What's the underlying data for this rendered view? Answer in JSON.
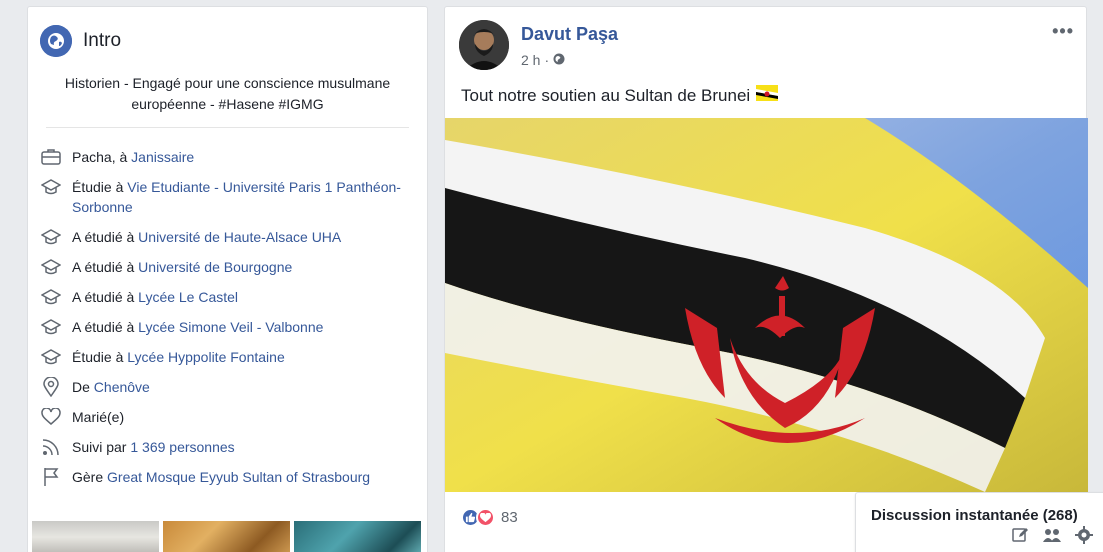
{
  "intro": {
    "title": "Intro",
    "bio": "Historien - Engagé pour une conscience musulmane européenne - #Hasene #IGMG",
    "items": [
      {
        "icon": "briefcase-icon",
        "prefix": "Pacha, à ",
        "link": "Janissaire"
      },
      {
        "icon": "graduation-cap-icon",
        "prefix": "Étudie à ",
        "link": "Vie Etudiante - Université Paris 1 Panthéon-Sorbonne"
      },
      {
        "icon": "graduation-cap-icon",
        "prefix": "A étudié à ",
        "link": "Université de Haute-Alsace UHA"
      },
      {
        "icon": "graduation-cap-icon",
        "prefix": "A étudié à ",
        "link": "Université de Bourgogne"
      },
      {
        "icon": "graduation-cap-icon",
        "prefix": "A étudié à ",
        "link": "Lycée Le Castel"
      },
      {
        "icon": "graduation-cap-icon",
        "prefix": "A étudié à ",
        "link": "Lycée Simone Veil - Valbonne"
      },
      {
        "icon": "graduation-cap-icon",
        "prefix": "Étudie à ",
        "link": "Lycée Hyppolite Fontaine"
      },
      {
        "icon": "location-pin-icon",
        "prefix": "De ",
        "link": "Chenôve"
      },
      {
        "icon": "heart-icon",
        "prefix": "Marié(e)",
        "link": ""
      },
      {
        "icon": "rss-icon",
        "prefix": "Suivi par ",
        "link": "1 369 personnes"
      },
      {
        "icon": "flag-icon",
        "prefix": "Gère ",
        "link": "Great Mosque Eyyub Sultan of Strasbourg"
      }
    ]
  },
  "post": {
    "author": "Davut Paşa",
    "time": "2 h",
    "dot": "·",
    "more": "•••",
    "text": "Tout notre soutien au Sultan de Brunei",
    "reaction_count": "83"
  },
  "chat": {
    "title": "Discussion instantanée (268)"
  },
  "colors": {
    "link": "#365899",
    "accent": "#4267b2",
    "love": "#f25268",
    "background": "#e9ebee"
  }
}
